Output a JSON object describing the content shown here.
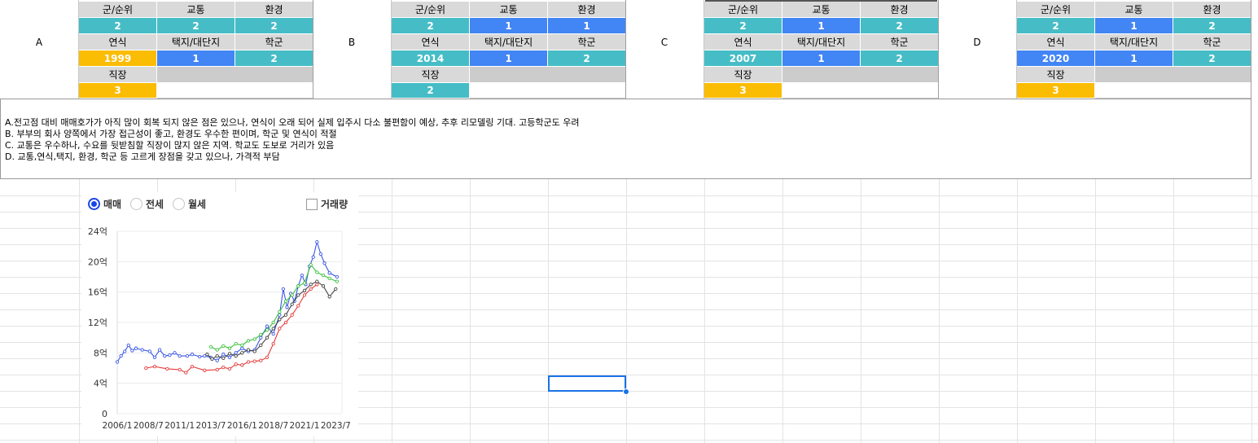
{
  "blocks": [
    {
      "letter": "A",
      "headers_row1": [
        "군/순위",
        "교통",
        "환경"
      ],
      "values_row1": [
        {
          "v": "2",
          "c": "teal"
        },
        {
          "v": "2",
          "c": "teal"
        },
        {
          "v": "2",
          "c": "teal"
        }
      ],
      "headers_row2": [
        "연식",
        "택지/대단지",
        "학군"
      ],
      "values_row2": [
        {
          "v": "1999",
          "c": "yellow"
        },
        {
          "v": "1",
          "c": "blue"
        },
        {
          "v": "2",
          "c": "teal"
        }
      ],
      "header_row3": "직장",
      "value_row3": {
        "v": "3",
        "c": "yellow"
      }
    },
    {
      "letter": "B",
      "headers_row1": [
        "군/순위",
        "교통",
        "환경"
      ],
      "values_row1": [
        {
          "v": "2",
          "c": "teal"
        },
        {
          "v": "1",
          "c": "blue"
        },
        {
          "v": "1",
          "c": "blue"
        }
      ],
      "headers_row2": [
        "연식",
        "택지/대단지",
        "학군"
      ],
      "values_row2": [
        {
          "v": "2014",
          "c": "teal"
        },
        {
          "v": "1",
          "c": "blue"
        },
        {
          "v": "2",
          "c": "teal"
        }
      ],
      "header_row3": "직장",
      "value_row3": {
        "v": "2",
        "c": "teal"
      }
    },
    {
      "letter": "C",
      "headers_row1": [
        "군/순위",
        "교통",
        "환경"
      ],
      "values_row1": [
        {
          "v": "2",
          "c": "teal"
        },
        {
          "v": "1",
          "c": "blue"
        },
        {
          "v": "2",
          "c": "teal"
        }
      ],
      "headers_row2": [
        "연식",
        "택지/대단지",
        "학군"
      ],
      "values_row2": [
        {
          "v": "2007",
          "c": "teal"
        },
        {
          "v": "1",
          "c": "blue"
        },
        {
          "v": "2",
          "c": "teal"
        }
      ],
      "header_row3": "직장",
      "value_row3": {
        "v": "3",
        "c": "yellow"
      }
    },
    {
      "letter": "D",
      "headers_row1": [
        "군/순위",
        "교통",
        "환경"
      ],
      "values_row1": [
        {
          "v": "2",
          "c": "teal"
        },
        {
          "v": "1",
          "c": "blue"
        },
        {
          "v": "2",
          "c": "teal"
        }
      ],
      "headers_row2": [
        "연식",
        "택지/대단지",
        "학군"
      ],
      "values_row2": [
        {
          "v": "2020",
          "c": "blue"
        },
        {
          "v": "1",
          "c": "blue"
        },
        {
          "v": "2",
          "c": "teal"
        }
      ],
      "header_row3": "직장",
      "value_row3": {
        "v": "3",
        "c": "yellow"
      }
    }
  ],
  "notes": [
    "A.전고점 대비 매매호가가 아직 많이 회복 되지 않은 점은 있으나, 연식이 오래 되어 실제 입주시 다소 불편함이 예상, 추후 리모델링 기대. 고등학군도 우려",
    "B. 부부의 회사 양쪽에서 가장 접근성이 좋고, 환경도 우수한 편이며, 학군 및 연식이 적절",
    "C. 교통은 우수하나, 수요를 뒷받침할 직장이 많지 않은 지역. 학교도 도보로 거리가 있음",
    "D. 교통,연식,택지, 환경, 학군 등 고르게 장점을 갖고 있으나, 가격적 부담"
  ],
  "chart_controls": {
    "radios": [
      {
        "label": "매매",
        "selected": true
      },
      {
        "label": "전세",
        "selected": false
      },
      {
        "label": "월세",
        "selected": false
      }
    ],
    "checkbox_label": "거래량",
    "checkbox_checked": false
  },
  "colors": {
    "teal": "#46bdc6",
    "blue": "#4285f4",
    "yellow": "#fbbc04",
    "header_gray": "#d9d9d9",
    "series_blue": "#3a56e8",
    "series_green": "#3cc13c",
    "series_red": "#e63b3b",
    "series_black": "#444444",
    "selection": "#1a73e8"
  },
  "chart_data": {
    "type": "line",
    "title": "",
    "xlabel": "",
    "ylabel": "",
    "x_ticks": [
      "2006/1",
      "2008/7",
      "2011/1",
      "2013/7",
      "2016/1",
      "2018/7",
      "2021/1",
      "2023/7"
    ],
    "y_ticks": [
      "0",
      "4억",
      "8억",
      "12억",
      "16억",
      "20억",
      "24억"
    ],
    "ylim": [
      0,
      24
    ],
    "xlim": [
      2006.0,
      2024.0
    ],
    "grid": true,
    "series": [
      {
        "color": "#3a56e8",
        "points": [
          [
            2006.0,
            6.8
          ],
          [
            2006.3,
            7.6
          ],
          [
            2006.6,
            8.2
          ],
          [
            2006.9,
            9.0
          ],
          [
            2007.2,
            8.3
          ],
          [
            2007.5,
            8.6
          ],
          [
            2008.0,
            8.4
          ],
          [
            2008.6,
            8.2
          ],
          [
            2009.0,
            7.4
          ],
          [
            2009.4,
            8.4
          ],
          [
            2009.8,
            7.6
          ],
          [
            2010.2,
            7.7
          ],
          [
            2010.6,
            8.0
          ],
          [
            2011.0,
            7.6
          ],
          [
            2011.6,
            7.6
          ],
          [
            2012.0,
            7.8
          ],
          [
            2012.6,
            7.5
          ],
          [
            2013.0,
            7.6
          ],
          [
            2013.5,
            7.4
          ],
          [
            2014.0,
            7.0
          ],
          [
            2014.5,
            7.8
          ],
          [
            2015.0,
            7.4
          ],
          [
            2015.5,
            8.0
          ],
          [
            2016.0,
            8.6
          ],
          [
            2016.5,
            8.2
          ],
          [
            2017.0,
            8.4
          ],
          [
            2017.5,
            10.0
          ],
          [
            2018.0,
            11.5
          ],
          [
            2018.5,
            10.5
          ],
          [
            2019.0,
            13.0
          ],
          [
            2019.3,
            16.4
          ],
          [
            2019.6,
            14.0
          ],
          [
            2019.9,
            15.8
          ],
          [
            2020.2,
            14.8
          ],
          [
            2020.5,
            16.8
          ],
          [
            2020.8,
            18.2
          ],
          [
            2021.1,
            17.0
          ],
          [
            2021.4,
            19.4
          ],
          [
            2021.7,
            20.6
          ],
          [
            2022.0,
            22.6
          ],
          [
            2022.3,
            21.0
          ],
          [
            2022.6,
            19.8
          ],
          [
            2023.0,
            18.5
          ],
          [
            2023.6,
            18.0
          ]
        ]
      },
      {
        "color": "#3cc13c",
        "points": [
          [
            2013.5,
            8.8
          ],
          [
            2014.0,
            8.4
          ],
          [
            2014.5,
            8.9
          ],
          [
            2015.0,
            8.6
          ],
          [
            2015.5,
            9.2
          ],
          [
            2016.0,
            9.0
          ],
          [
            2016.5,
            9.6
          ],
          [
            2017.0,
            9.8
          ],
          [
            2017.5,
            10.4
          ],
          [
            2018.0,
            11.0
          ],
          [
            2018.5,
            12.0
          ],
          [
            2019.0,
            13.4
          ],
          [
            2019.5,
            14.8
          ],
          [
            2020.0,
            15.6
          ],
          [
            2020.5,
            16.8
          ],
          [
            2021.0,
            17.2
          ],
          [
            2021.5,
            19.6
          ],
          [
            2022.0,
            18.6
          ],
          [
            2022.5,
            18.2
          ],
          [
            2023.0,
            17.8
          ],
          [
            2023.6,
            17.4
          ]
        ]
      },
      {
        "color": "#e63b3b",
        "points": [
          [
            2008.3,
            6.0
          ],
          [
            2009.0,
            6.2
          ],
          [
            2010.0,
            5.9
          ],
          [
            2011.0,
            5.8
          ],
          [
            2011.5,
            5.4
          ],
          [
            2012.0,
            6.2
          ],
          [
            2013.0,
            5.7
          ],
          [
            2014.0,
            5.8
          ],
          [
            2014.5,
            6.1
          ],
          [
            2015.0,
            5.9
          ],
          [
            2015.5,
            6.5
          ],
          [
            2016.0,
            6.4
          ],
          [
            2016.5,
            6.8
          ],
          [
            2017.0,
            6.9
          ],
          [
            2017.5,
            7.0
          ],
          [
            2018.0,
            7.4
          ],
          [
            2018.5,
            9.2
          ],
          [
            2019.0,
            11.2
          ],
          [
            2019.5,
            12.0
          ],
          [
            2020.0,
            13.0
          ],
          [
            2020.5,
            14.2
          ],
          [
            2021.0,
            15.6
          ],
          [
            2021.5,
            16.4
          ],
          [
            2022.0,
            17.0
          ]
        ]
      },
      {
        "color": "#444444",
        "points": [
          [
            2013.2,
            7.8
          ],
          [
            2013.6,
            7.2
          ],
          [
            2014.0,
            7.6
          ],
          [
            2014.5,
            7.3
          ],
          [
            2015.0,
            7.9
          ],
          [
            2015.5,
            7.6
          ],
          [
            2016.0,
            8.0
          ],
          [
            2016.5,
            8.4
          ],
          [
            2017.0,
            8.2
          ],
          [
            2017.5,
            9.0
          ],
          [
            2018.0,
            10.0
          ],
          [
            2018.5,
            11.2
          ],
          [
            2019.0,
            12.4
          ],
          [
            2019.5,
            13.0
          ],
          [
            2020.0,
            14.4
          ],
          [
            2020.5,
            15.6
          ],
          [
            2021.0,
            16.2
          ],
          [
            2021.5,
            17.0
          ],
          [
            2022.0,
            17.4
          ],
          [
            2022.5,
            16.8
          ],
          [
            2023.0,
            15.4
          ],
          [
            2023.5,
            16.4
          ]
        ]
      }
    ]
  }
}
